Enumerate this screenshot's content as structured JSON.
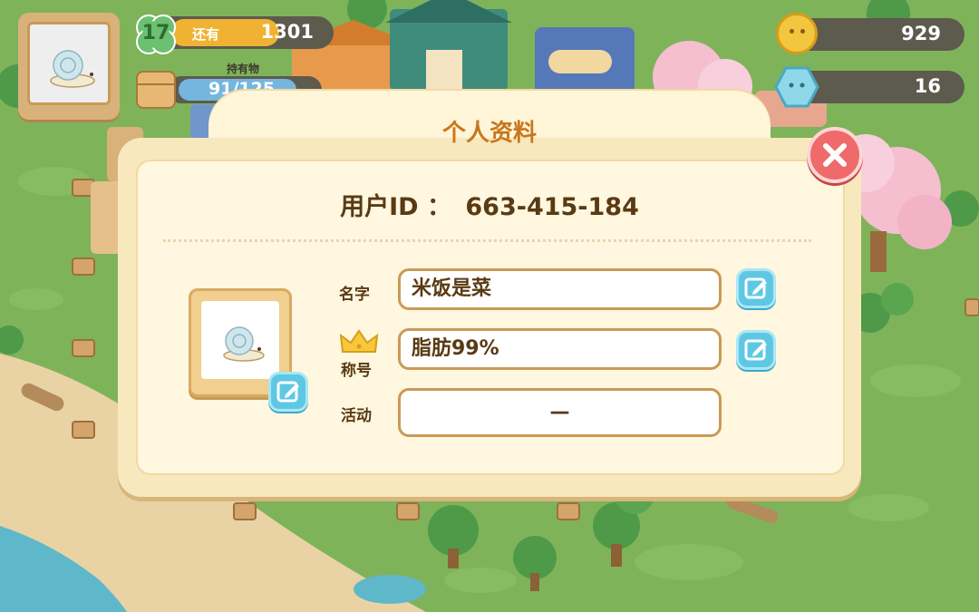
{
  "hud": {
    "level": "17",
    "remaining_label": "还有",
    "remaining_value": "1301",
    "inventory_label": "持有物",
    "inventory_value": "91/125",
    "coins": "929",
    "gems": "16"
  },
  "dialog": {
    "title": "个人资料",
    "user_id_label": "用户ID ：",
    "user_id": "663-415-184",
    "fields": {
      "name": {
        "label": "名字",
        "value": "米饭是菜"
      },
      "title": {
        "label": "称号",
        "value": "脂肪99%"
      },
      "activity": {
        "label": "活动",
        "value": "—"
      }
    }
  },
  "colors": {
    "grass": "#7fb35a",
    "sand": "#e9d3a5",
    "water": "#5fb8c9",
    "panel": "#fff7df",
    "panel_border": "#f2d9a2",
    "title_text": "#c8771e",
    "text_brown": "#5a3a14",
    "close_red": "#ef6a6a",
    "edit_blue": "#5ec8e4"
  },
  "icons": [
    "close-icon",
    "edit-icon",
    "crown-icon",
    "snail-avatar-icon",
    "clover-icon",
    "box-icon",
    "coin-icon",
    "gem-icon"
  ]
}
